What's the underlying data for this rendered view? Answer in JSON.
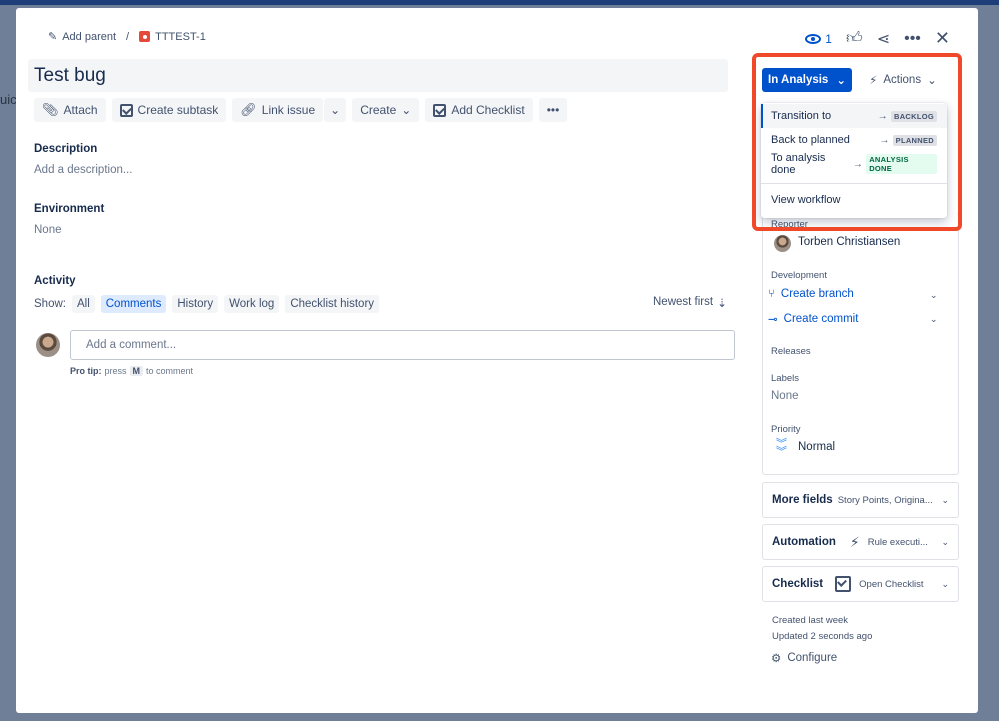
{
  "backdrop": {
    "peek_text": "uick"
  },
  "header": {
    "add_parent": "Add parent",
    "issue_key": "TTTEST-1",
    "watch_count": "1"
  },
  "issue": {
    "title": "Test bug"
  },
  "toolbar": {
    "attach": "Attach",
    "create_subtask": "Create subtask",
    "link_issue": "Link issue",
    "create": "Create",
    "add_checklist": "Add Checklist"
  },
  "description": {
    "label": "Description",
    "placeholder": "Add a description..."
  },
  "environment": {
    "label": "Environment",
    "value": "None"
  },
  "activity": {
    "label": "Activity",
    "show_label": "Show:",
    "filters": [
      "All",
      "Comments",
      "History",
      "Work log",
      "Checklist history"
    ],
    "active_filter": "Comments",
    "sort": "Newest first",
    "comment_placeholder": "Add a comment...",
    "protip_bold": "Pro tip:",
    "protip_press": "press",
    "protip_key": "M",
    "protip_end": "to comment"
  },
  "status": {
    "current": "In Analysis",
    "actions": "Actions"
  },
  "transitions": [
    {
      "label": "Transition to",
      "target": "BACKLOG",
      "style": "grey"
    },
    {
      "label": "Back to planned",
      "target": "PLANNED",
      "style": "grey"
    },
    {
      "label": "To analysis done",
      "target": "ANALYSIS DONE",
      "style": "green"
    }
  ],
  "view_workflow": "View workflow",
  "details": {
    "reporter_label": "Reporter",
    "reporter_name": "Torben Christiansen",
    "development_label": "Development",
    "create_branch": "Create branch",
    "create_commit": "Create commit",
    "releases_label": "Releases",
    "labels_label": "Labels",
    "labels_value": "None",
    "priority_label": "Priority",
    "priority_value": "Normal"
  },
  "panels": {
    "more_fields": "More fields",
    "more_fields_sub": "Story Points, Origina...",
    "automation": "Automation",
    "automation_sub": "Rule executi...",
    "checklist": "Checklist",
    "checklist_sub": "Open Checklist"
  },
  "meta": {
    "created": "Created last week",
    "updated": "Updated 2 seconds ago",
    "configure": "Configure"
  },
  "colors": {
    "primary": "#0052cc",
    "highlight": "#f0492a",
    "bug": "#e5493a"
  }
}
